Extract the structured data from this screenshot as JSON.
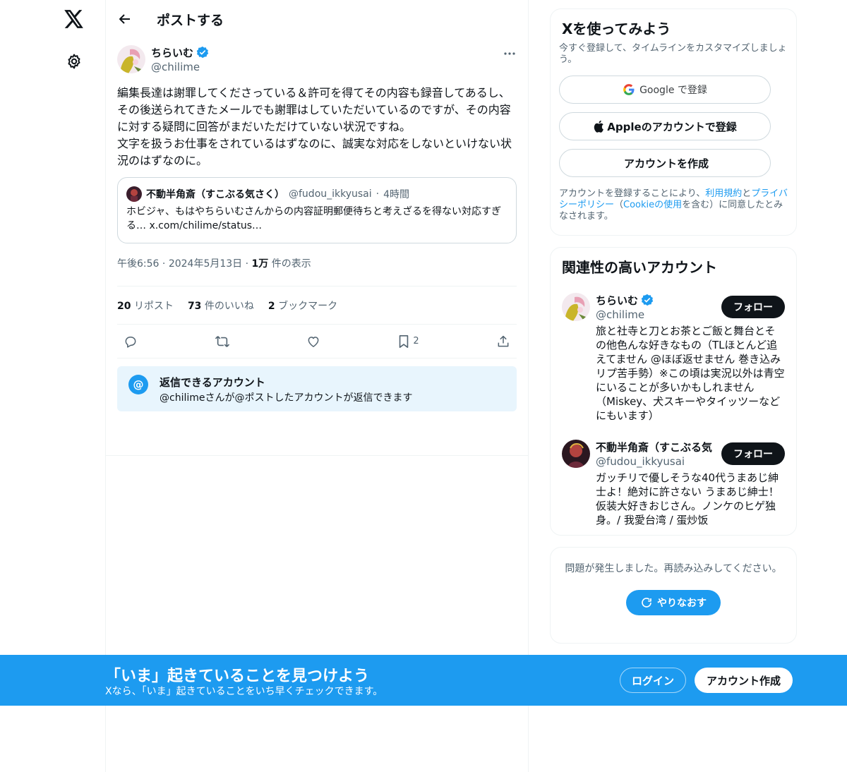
{
  "nav": {
    "logo_icon": "x-logo-icon",
    "settings_icon": "gear-icon"
  },
  "header": {
    "title": "ポストする",
    "back_icon": "arrow-left-icon"
  },
  "post": {
    "author_name": "ちらいむ",
    "author_handle": "@chilime",
    "text": "編集長達は謝罪してくださっている＆許可を得てその内容も録音してあるし、その後送られてきたメールでも謝罪はしていただいているのですが、その内容に対する疑問に回答がまだいただけていない状況ですね。\n文字を扱うお仕事をされているはずなのに、誠実な対応をしないといけない状況のはずなのに。",
    "quote": {
      "name": "不動半角斎（すこぶる気さく）",
      "handle": "@fudou_ikkyusai",
      "time": "4時間",
      "text": "ホビジャ、もはやちらいむさんからの内容証明郵便待ちと考えざるを得ない対応すぎる… x.com/chilime/status…"
    },
    "time": "午後6:56",
    "date": "2024年5月13日",
    "views_count": "1万",
    "views_label": "件の表示",
    "stats": {
      "reposts_count": "20",
      "reposts_label": "リポスト",
      "likes_count": "73",
      "likes_label": "件のいいね",
      "bookmarks_count": "2",
      "bookmarks_label": "ブックマーク"
    },
    "actions": {
      "bookmark_count": "2"
    },
    "reply_info": {
      "title": "返信できるアカウント",
      "sub": "@chilimeさんが@ポストしたアカウントが返信できます"
    }
  },
  "signup": {
    "title": "Xを使ってみよう",
    "sub": "今すぐ登録して、タイムラインをカスタマイズしましょう。",
    "google_brand": "Google",
    "google_suffix": "で登録",
    "apple_label": "Appleのアカウントで登録",
    "create_label": "アカウントを作成",
    "legal_pre": "アカウントを登録することにより、",
    "legal_terms": "利用規約",
    "legal_and": "と",
    "legal_privacy": "プライバシーポリシー",
    "legal_paren_open": "（",
    "legal_cookie": "Cookieの使用",
    "legal_post": "を含む）に同意したとみなされます。"
  },
  "related": {
    "title": "関連性の高いアカウント",
    "follow_label": "フォロー",
    "accounts": [
      {
        "name": "ちらいむ",
        "handle": "@chilime",
        "bio": "旅と社寺と刀とお茶とご飯と舞台とその他色んな好きなもの（TLほとんど追えてません @ほぼ返せません 巻き込みリプ苦手勢）※この頃は実況以外は青空にいることが多いかもしれません（Miskey、犬スキーやタイッツーなどにもいます）"
      },
      {
        "name": "不動半角斎（すこぶる気",
        "handle": "@fudou_ikkyusai",
        "bio": "ガッチリで優しそうな40代うまあじ紳士よ！絶対に許さない うまあじ紳士！仮装大好きおじさん。ノンケのヒゲ独身。/ 我愛台湾 / 蛋炒饭"
      }
    ]
  },
  "error": {
    "text": "問題が発生しました。再読み込みしてください。",
    "retry_label": "やりなおす"
  },
  "bottom": {
    "title": "「いま」起きていることを見つけよう",
    "sub": "Xなら、「いま」起きていることをいち早くチェックできます。",
    "login_label": "ログイン",
    "signup_label": "アカウント作成"
  },
  "colors": {
    "accent": "#1d9bf0",
    "text": "#0f1419",
    "muted": "#536471",
    "border": "#eff3f4"
  }
}
